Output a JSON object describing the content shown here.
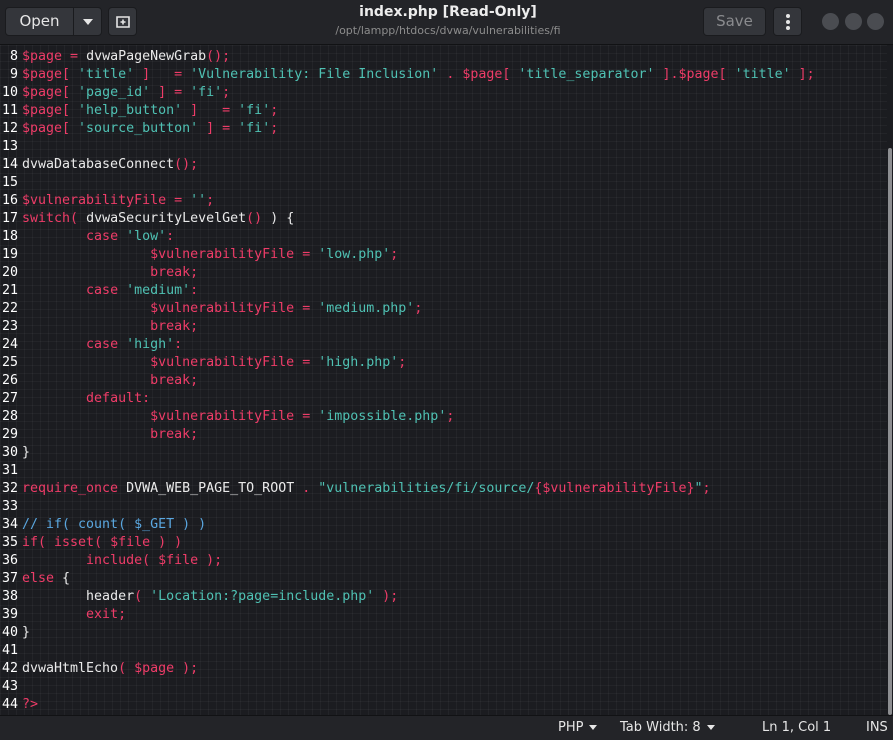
{
  "header": {
    "open_label": "Open",
    "title": "index.php [Read-Only]",
    "subtitle": "/opt/lampp/htdocs/dvwa/vulnerabilities/fi",
    "save_label": "Save"
  },
  "status": {
    "language": "PHP",
    "tab_width": "Tab Width: 8",
    "position": "Ln 1, Col 1",
    "mode": "INS"
  },
  "code": {
    "ln8": "8",
    "ln9": "9",
    "ln10": "10",
    "ln11": "11",
    "ln12": "12",
    "ln13": "13",
    "ln14": "14",
    "ln15": "15",
    "ln16": "16",
    "ln17": "17",
    "ln18": "18",
    "ln19": "19",
    "ln20": "20",
    "ln21": "21",
    "ln22": "22",
    "ln23": "23",
    "ln24": "24",
    "ln25": "25",
    "ln26": "26",
    "ln27": "27",
    "ln28": "28",
    "ln29": "29",
    "ln30": "30",
    "ln31": "31",
    "ln32": "32",
    "ln33": "33",
    "ln34": "34",
    "ln35": "35",
    "ln36": "36",
    "ln37": "37",
    "ln38": "38",
    "ln39": "39",
    "ln40": "40",
    "ln41": "41",
    "ln42": "42",
    "ln43": "43",
    "ln44": "44",
    "t8": [
      "$page",
      " = ",
      "dvwaPageNewGrab",
      "();"
    ],
    "t9": [
      "$page",
      "[ ",
      "'title'",
      " ]   = ",
      "'Vulnerability: File Inclusion'",
      " . ",
      "$page",
      "[ ",
      "'title_separator'",
      " ].",
      "$page",
      "[ ",
      "'title'",
      " ];"
    ],
    "t10": [
      "$page",
      "[ ",
      "'page_id'",
      " ] = ",
      "'fi'",
      ";"
    ],
    "t11": [
      "$page",
      "[ ",
      "'help_button'",
      " ]   = ",
      "'fi'",
      ";"
    ],
    "t12": [
      "$page",
      "[ ",
      "'source_button'",
      " ] = ",
      "'fi'",
      ";"
    ],
    "t14": [
      "dvwaDatabaseConnect",
      "();"
    ],
    "t16": [
      "$vulnerabilityFile",
      " = ",
      "''",
      ";"
    ],
    "t17": [
      "switch",
      "( ",
      "dvwaSecurityLevelGet",
      "()",
      " ) {"
    ],
    "t18": [
      "        ",
      "case",
      " ",
      "'low'",
      ":"
    ],
    "t19": [
      "                ",
      "$vulnerabilityFile",
      " = ",
      "'low.php'",
      ";"
    ],
    "t20": [
      "                ",
      "break",
      ";"
    ],
    "t21": [
      "        ",
      "case",
      " ",
      "'medium'",
      ":"
    ],
    "t22": [
      "                ",
      "$vulnerabilityFile",
      " = ",
      "'medium.php'",
      ";"
    ],
    "t23": [
      "                ",
      "break",
      ";"
    ],
    "t24": [
      "        ",
      "case",
      " ",
      "'high'",
      ":"
    ],
    "t25": [
      "                ",
      "$vulnerabilityFile",
      " = ",
      "'high.php'",
      ";"
    ],
    "t26": [
      "                ",
      "break",
      ";"
    ],
    "t27": [
      "        ",
      "default",
      ":"
    ],
    "t28": [
      "                ",
      "$vulnerabilityFile",
      " = ",
      "'impossible.php'",
      ";"
    ],
    "t29": [
      "                ",
      "break",
      ";"
    ],
    "t30": [
      "}"
    ],
    "t32": [
      "require_once",
      " ",
      "DVWA_WEB_PAGE_TO_ROOT",
      " . ",
      "\"vulnerabilities/fi/source/",
      "{$vulnerabilityFile}",
      "\"",
      ";"
    ],
    "t34": [
      "// if( count( $_GET ) )"
    ],
    "t35": [
      "if",
      "( ",
      "isset",
      "( ",
      "$file",
      " ) )"
    ],
    "t36": [
      "        ",
      "include",
      "( ",
      "$file",
      " );"
    ],
    "t37": [
      "else",
      " {"
    ],
    "t38": [
      "        ",
      "header",
      "( ",
      "'Location:?page=include.php'",
      " );"
    ],
    "t39": [
      "        ",
      "exit",
      ";"
    ],
    "t40": [
      "}"
    ],
    "t42": [
      "dvwaHtmlEcho",
      "( ",
      "$page",
      " );"
    ],
    "t44": [
      "?>"
    ]
  }
}
